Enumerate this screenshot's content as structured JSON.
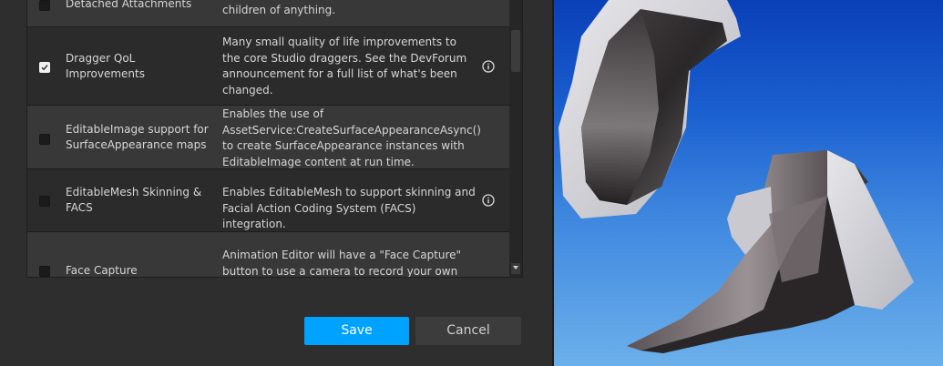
{
  "betas": [
    {
      "name": "Detached Attachments",
      "description": "children of anything.",
      "checked": false,
      "has_info": false
    },
    {
      "name": "Dragger QoL Improvements",
      "description": "Many small quality of life improvements to the core Studio draggers. See the DevForum announcement for a full list of what's been changed.",
      "checked": true,
      "has_info": true
    },
    {
      "name": "EditableImage support for SurfaceAppearance maps",
      "description": "Enables the use of AssetService:CreateSurfaceAppearanceAsync() to create SurfaceAppearance instances with EditableImage content at run time.",
      "checked": false,
      "has_info": false
    },
    {
      "name": "EditableMesh Skinning & FACS",
      "description": "Enables EditableMesh to support skinning and Facial Action Coding System (FACS) integration.",
      "checked": false,
      "has_info": true
    },
    {
      "name": "Face Capture",
      "description": "Animation Editor will have a \"Face Capture\" button to use a camera to record your own face",
      "checked": false,
      "has_info": false
    }
  ],
  "buttons": {
    "save_label": "Save",
    "cancel_label": "Cancel"
  },
  "colors": {
    "accent": "#00a2ff",
    "panel": "#2e2e2e",
    "row_alt": "#383838",
    "row_base": "#2b2b2b"
  }
}
